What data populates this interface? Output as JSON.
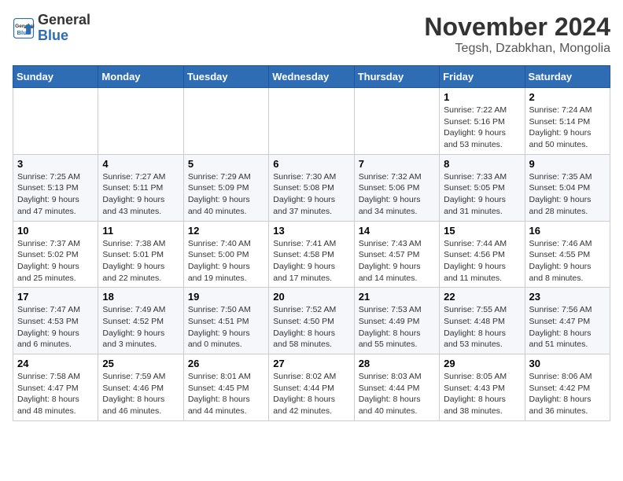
{
  "logo": {
    "general": "General",
    "blue": "Blue"
  },
  "header": {
    "month": "November 2024",
    "location": "Tegsh, Dzabkhan, Mongolia"
  },
  "weekdays": [
    "Sunday",
    "Monday",
    "Tuesday",
    "Wednesday",
    "Thursday",
    "Friday",
    "Saturday"
  ],
  "weeks": [
    [
      {
        "day": "",
        "info": ""
      },
      {
        "day": "",
        "info": ""
      },
      {
        "day": "",
        "info": ""
      },
      {
        "day": "",
        "info": ""
      },
      {
        "day": "",
        "info": ""
      },
      {
        "day": "1",
        "info": "Sunrise: 7:22 AM\nSunset: 5:16 PM\nDaylight: 9 hours and 53 minutes."
      },
      {
        "day": "2",
        "info": "Sunrise: 7:24 AM\nSunset: 5:14 PM\nDaylight: 9 hours and 50 minutes."
      }
    ],
    [
      {
        "day": "3",
        "info": "Sunrise: 7:25 AM\nSunset: 5:13 PM\nDaylight: 9 hours and 47 minutes."
      },
      {
        "day": "4",
        "info": "Sunrise: 7:27 AM\nSunset: 5:11 PM\nDaylight: 9 hours and 43 minutes."
      },
      {
        "day": "5",
        "info": "Sunrise: 7:29 AM\nSunset: 5:09 PM\nDaylight: 9 hours and 40 minutes."
      },
      {
        "day": "6",
        "info": "Sunrise: 7:30 AM\nSunset: 5:08 PM\nDaylight: 9 hours and 37 minutes."
      },
      {
        "day": "7",
        "info": "Sunrise: 7:32 AM\nSunset: 5:06 PM\nDaylight: 9 hours and 34 minutes."
      },
      {
        "day": "8",
        "info": "Sunrise: 7:33 AM\nSunset: 5:05 PM\nDaylight: 9 hours and 31 minutes."
      },
      {
        "day": "9",
        "info": "Sunrise: 7:35 AM\nSunset: 5:04 PM\nDaylight: 9 hours and 28 minutes."
      }
    ],
    [
      {
        "day": "10",
        "info": "Sunrise: 7:37 AM\nSunset: 5:02 PM\nDaylight: 9 hours and 25 minutes."
      },
      {
        "day": "11",
        "info": "Sunrise: 7:38 AM\nSunset: 5:01 PM\nDaylight: 9 hours and 22 minutes."
      },
      {
        "day": "12",
        "info": "Sunrise: 7:40 AM\nSunset: 5:00 PM\nDaylight: 9 hours and 19 minutes."
      },
      {
        "day": "13",
        "info": "Sunrise: 7:41 AM\nSunset: 4:58 PM\nDaylight: 9 hours and 17 minutes."
      },
      {
        "day": "14",
        "info": "Sunrise: 7:43 AM\nSunset: 4:57 PM\nDaylight: 9 hours and 14 minutes."
      },
      {
        "day": "15",
        "info": "Sunrise: 7:44 AM\nSunset: 4:56 PM\nDaylight: 9 hours and 11 minutes."
      },
      {
        "day": "16",
        "info": "Sunrise: 7:46 AM\nSunset: 4:55 PM\nDaylight: 9 hours and 8 minutes."
      }
    ],
    [
      {
        "day": "17",
        "info": "Sunrise: 7:47 AM\nSunset: 4:53 PM\nDaylight: 9 hours and 6 minutes."
      },
      {
        "day": "18",
        "info": "Sunrise: 7:49 AM\nSunset: 4:52 PM\nDaylight: 9 hours and 3 minutes."
      },
      {
        "day": "19",
        "info": "Sunrise: 7:50 AM\nSunset: 4:51 PM\nDaylight: 9 hours and 0 minutes."
      },
      {
        "day": "20",
        "info": "Sunrise: 7:52 AM\nSunset: 4:50 PM\nDaylight: 8 hours and 58 minutes."
      },
      {
        "day": "21",
        "info": "Sunrise: 7:53 AM\nSunset: 4:49 PM\nDaylight: 8 hours and 55 minutes."
      },
      {
        "day": "22",
        "info": "Sunrise: 7:55 AM\nSunset: 4:48 PM\nDaylight: 8 hours and 53 minutes."
      },
      {
        "day": "23",
        "info": "Sunrise: 7:56 AM\nSunset: 4:47 PM\nDaylight: 8 hours and 51 minutes."
      }
    ],
    [
      {
        "day": "24",
        "info": "Sunrise: 7:58 AM\nSunset: 4:47 PM\nDaylight: 8 hours and 48 minutes."
      },
      {
        "day": "25",
        "info": "Sunrise: 7:59 AM\nSunset: 4:46 PM\nDaylight: 8 hours and 46 minutes."
      },
      {
        "day": "26",
        "info": "Sunrise: 8:01 AM\nSunset: 4:45 PM\nDaylight: 8 hours and 44 minutes."
      },
      {
        "day": "27",
        "info": "Sunrise: 8:02 AM\nSunset: 4:44 PM\nDaylight: 8 hours and 42 minutes."
      },
      {
        "day": "28",
        "info": "Sunrise: 8:03 AM\nSunset: 4:44 PM\nDaylight: 8 hours and 40 minutes."
      },
      {
        "day": "29",
        "info": "Sunrise: 8:05 AM\nSunset: 4:43 PM\nDaylight: 8 hours and 38 minutes."
      },
      {
        "day": "30",
        "info": "Sunrise: 8:06 AM\nSunset: 4:42 PM\nDaylight: 8 hours and 36 minutes."
      }
    ]
  ]
}
